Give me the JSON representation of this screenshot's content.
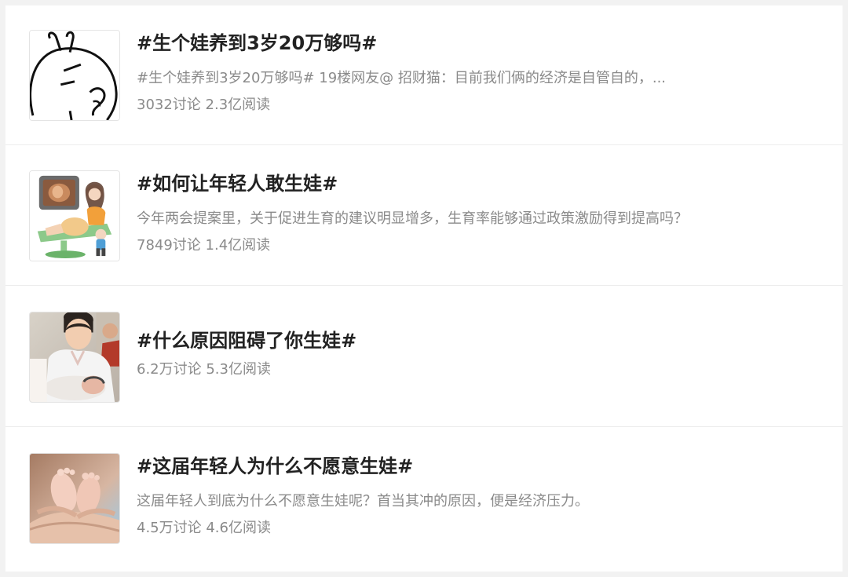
{
  "topics": [
    {
      "title": "#生个娃养到3岁20万够吗#",
      "description": "#生个娃养到3岁20万够吗# 19楼网友@ 招财猫：目前我们俩的经济是自管自的，...",
      "stats": "3032讨论 2.3亿阅读",
      "thumbnail_icon": "cartoon-rabbit-thinking-icon"
    },
    {
      "title": "#如何让年轻人敢生娃#",
      "description": "今年两会提案里，关于促进生育的建议明显增多，生育率能够通过政策激励得到提高吗？",
      "stats": "7849讨论 1.4亿阅读",
      "thumbnail_icon": "pregnancy-ultrasound-illustration-icon"
    },
    {
      "title": "#什么原因阻碍了你生娃#",
      "description": "",
      "stats": "6.2万讨论 5.3亿阅读",
      "thumbnail_icon": "nurse-holding-newborn-photo"
    },
    {
      "title": "#这届年轻人为什么不愿意生娃#",
      "description": "这届年轻人到底为什么不愿意生娃呢？首当其冲的原因，便是经济压力。",
      "stats": "4.5万讨论 4.6亿阅读",
      "thumbnail_icon": "baby-feet-in-hands-photo"
    }
  ]
}
